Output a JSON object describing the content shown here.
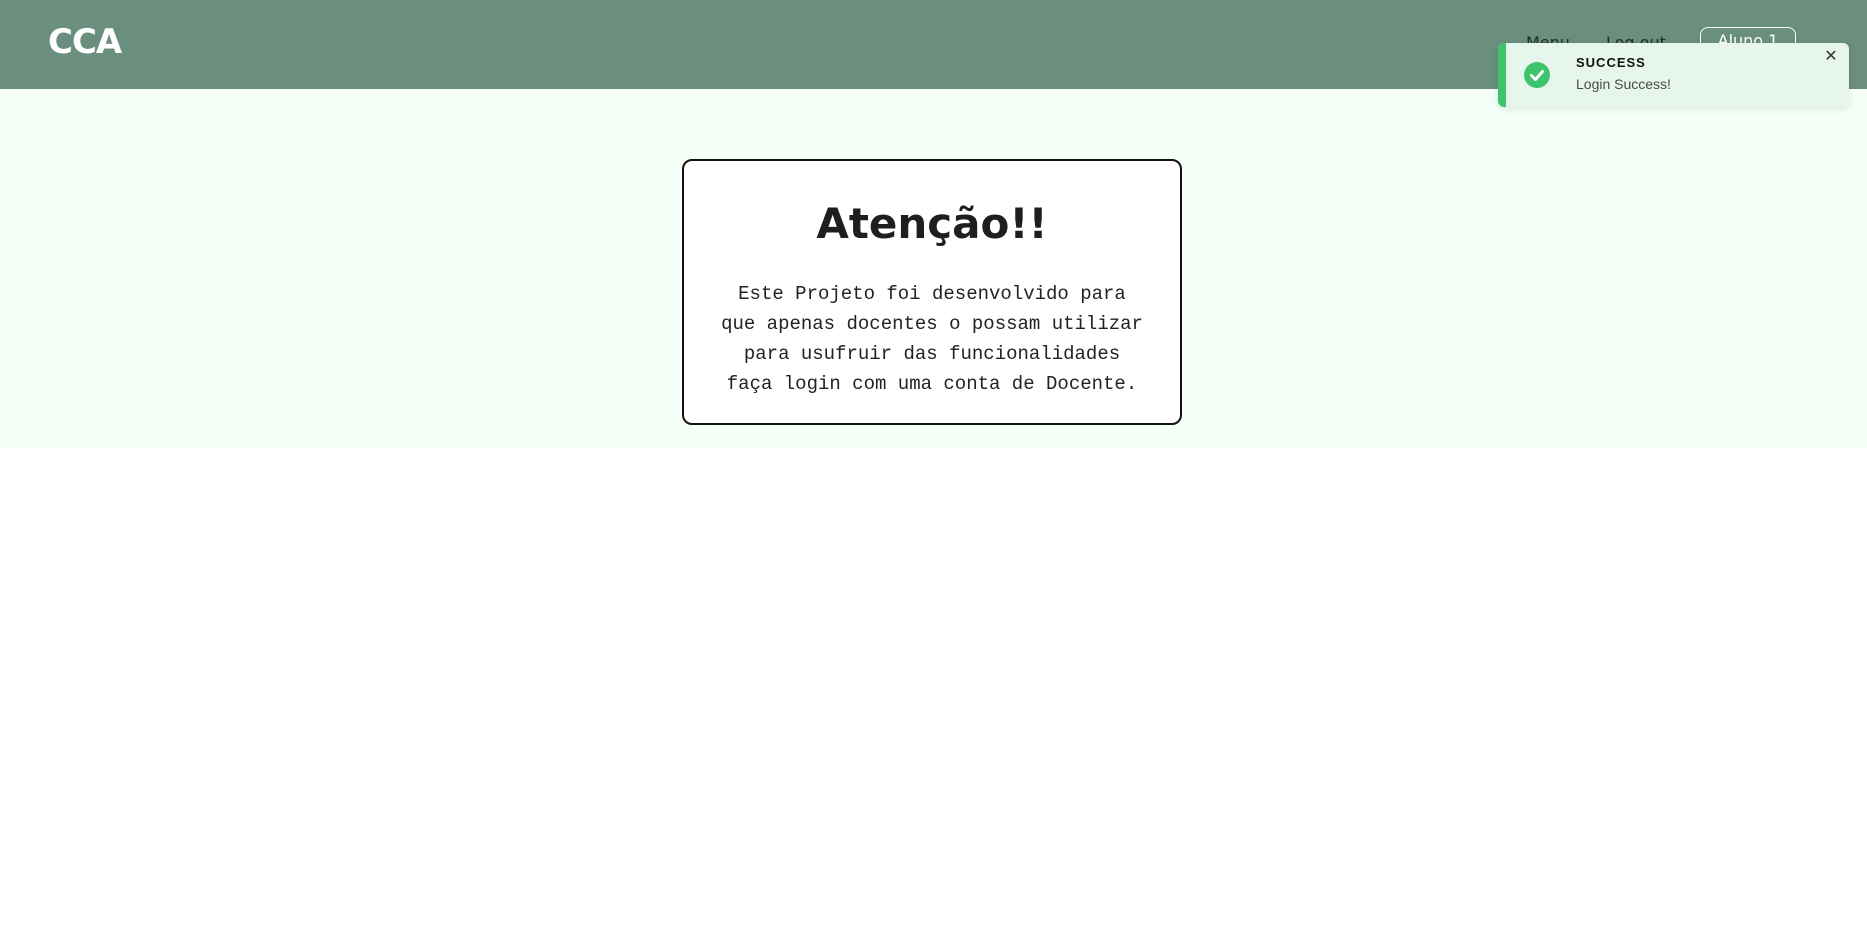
{
  "navbar": {
    "brand": "CCA",
    "links": [
      {
        "label": "Menu"
      },
      {
        "label": "Log out"
      }
    ],
    "user_label": "Aluno 1",
    "background": "#6b8f7e"
  },
  "notice": {
    "title": "Atenção!!",
    "lines": [
      "Este Projeto foi desenvolvido para",
      "que apenas docentes o possam utilizar",
      "para usufruir das funcionalidades",
      "faça login com uma conta de Docente."
    ]
  },
  "toast": {
    "title": "SUCCESS",
    "message": "Login Success!",
    "icon": "check-circle-icon",
    "close_icon": "close-icon",
    "close_glyph": "✕",
    "accent_color": "#3ec46d"
  }
}
